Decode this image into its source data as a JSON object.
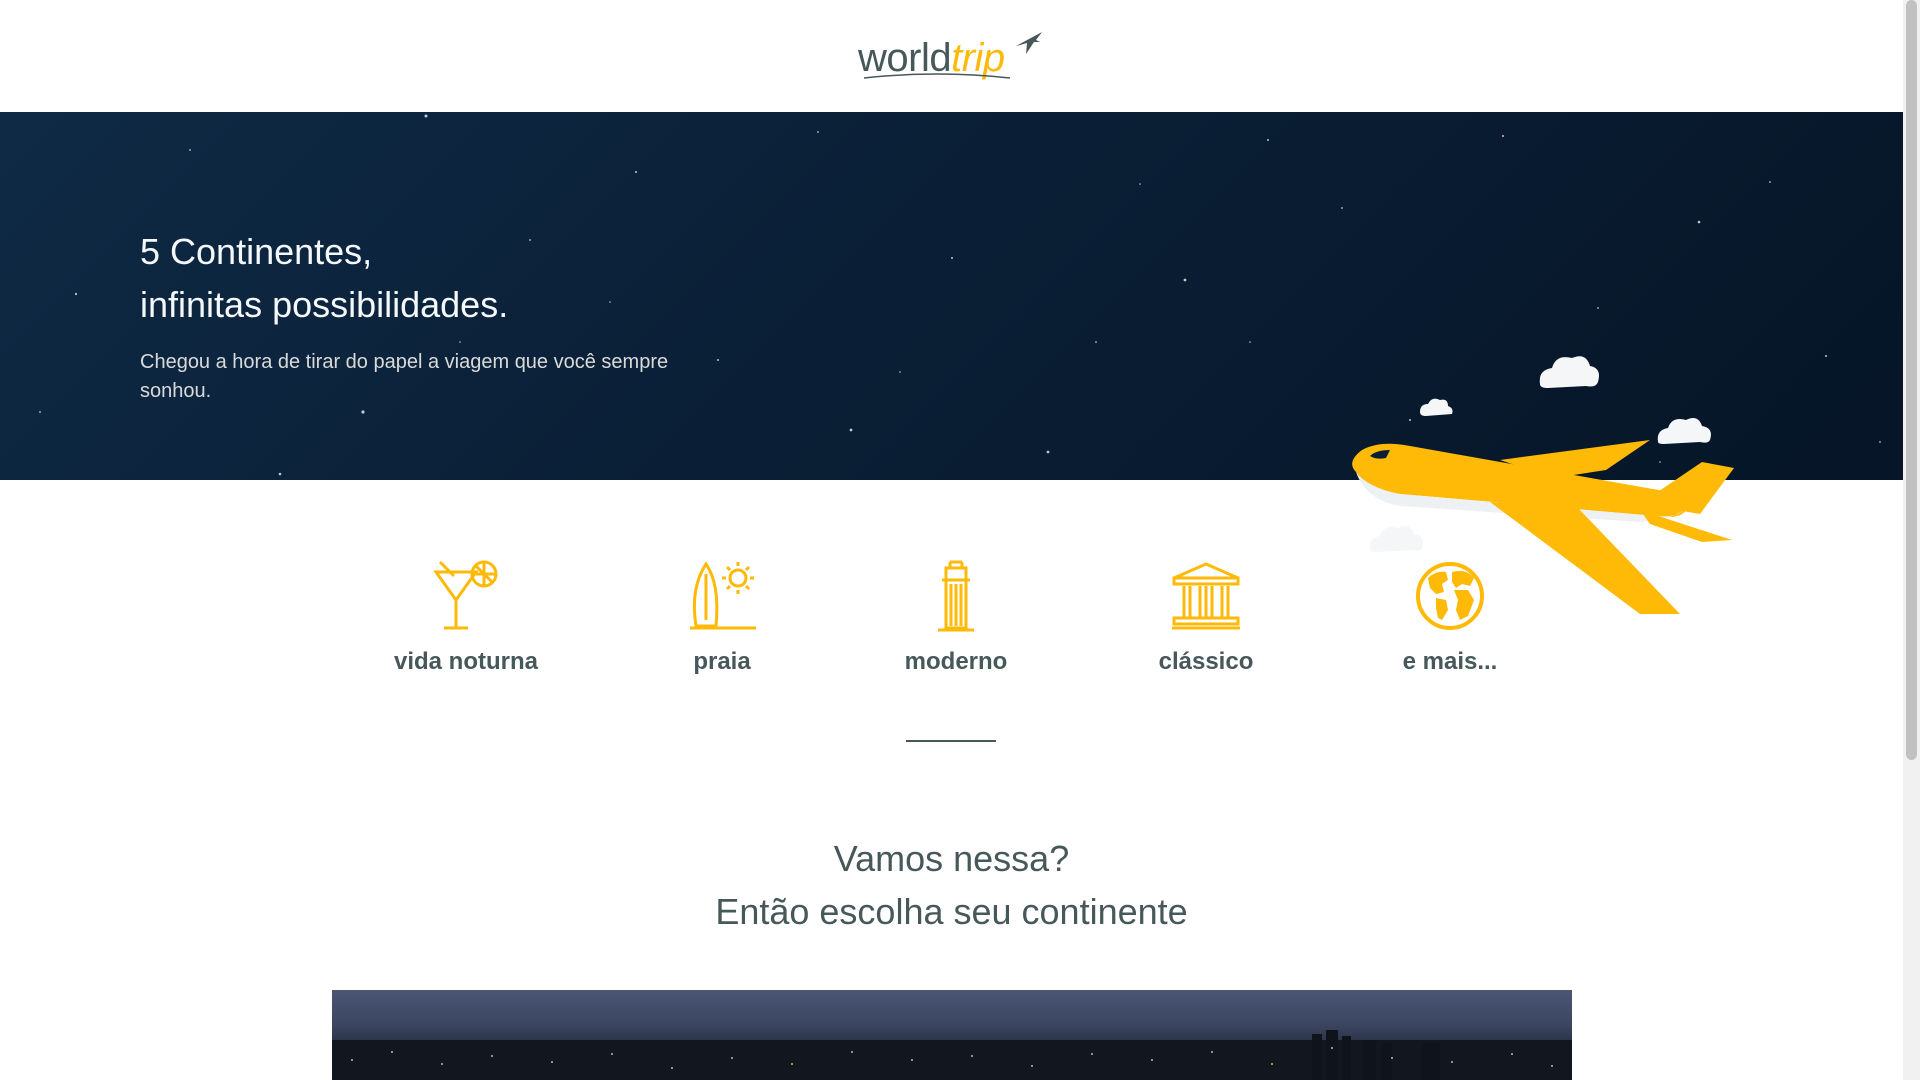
{
  "header": {
    "logo_part1": "world",
    "logo_part2": "trip"
  },
  "hero": {
    "title_line1": "5 Continentes,",
    "title_line2": "infinitas possibilidades.",
    "subtitle": "Chegou a hora de tirar do papel a viagem que você sempre sonhou."
  },
  "travel_types": [
    {
      "label": "vida noturna",
      "icon": "cocktail-icon"
    },
    {
      "label": "praia",
      "icon": "surfboard-sun-icon"
    },
    {
      "label": "moderno",
      "icon": "skyscraper-icon"
    },
    {
      "label": "clássico",
      "icon": "museum-icon"
    },
    {
      "label": "e mais...",
      "icon": "globe-icon"
    }
  ],
  "cta": {
    "line1": "Vamos nessa?",
    "line2": "Então escolha seu continente"
  },
  "colors": {
    "accent": "#FFBA08",
    "text_dark": "#47585B",
    "hero_bg": "#0a1f36",
    "hero_text": "#F5F8FA"
  }
}
